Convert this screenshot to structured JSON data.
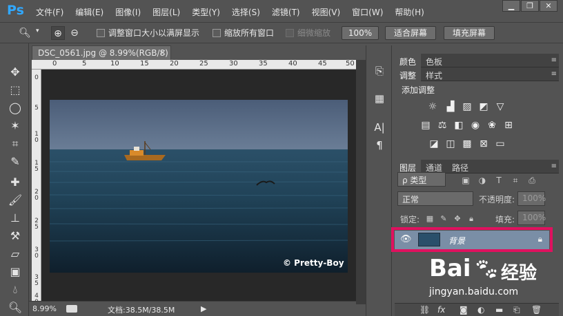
{
  "app": {
    "logo": "Ps"
  },
  "menu": [
    "文件(F)",
    "编辑(E)",
    "图像(I)",
    "图层(L)",
    "类型(Y)",
    "选择(S)",
    "滤镜(T)",
    "视图(V)",
    "窗口(W)",
    "帮助(H)"
  ],
  "window_controls": [
    "▁",
    "❐",
    "✕"
  ],
  "options": {
    "resize_windows": "调整窗口大小以满屏显示",
    "zoom_all": "缩放所有窗口",
    "scrubby_zoom": "细微缩放",
    "btn_100": "100%",
    "btn_fit": "适合屏幕",
    "btn_fill": "填充屏幕"
  },
  "document": {
    "tab_title": "DSC_0561.jpg @ 8.99%(RGB/8)",
    "close": "×",
    "ruler_top": [
      "0",
      "5",
      "10",
      "15",
      "20",
      "25",
      "30",
      "35",
      "40",
      "45",
      "50"
    ],
    "ruler_left": [
      "0",
      "5",
      "1\n0",
      "1\n5",
      "2\n0",
      "2\n5",
      "3\n0",
      "3\n5",
      "4\n0"
    ],
    "watermark": "© Pretty-Boy"
  },
  "status": {
    "zoom": "8.99%",
    "doc_size": "文档:38.5M/38.5M",
    "arrow": "▶"
  },
  "panels": {
    "color": {
      "tabs": [
        "颜色",
        "色板"
      ]
    },
    "adjustments": {
      "tabs": [
        "调整",
        "样式"
      ],
      "add_label": "添加调整"
    },
    "layers": {
      "tabs": [
        "图层",
        "通道",
        "路径"
      ],
      "filter_kind": "ρ 类型",
      "blend_mode": "正常",
      "opacity_label": "不透明度:",
      "opacity_value": "100%",
      "lock_label": "锁定:",
      "fill_label": "填充:",
      "fill_value": "100%",
      "layer_name": "背景"
    }
  },
  "overlay": {
    "baidu_logo": "Bai",
    "baidu_jingyan": "经验",
    "baidu_url": "jingyan.baidu.com"
  },
  "colors": {
    "highlight": "#e0115f",
    "layer_selected": "#7a8ea6",
    "ps_blue": "#31a8ff"
  }
}
